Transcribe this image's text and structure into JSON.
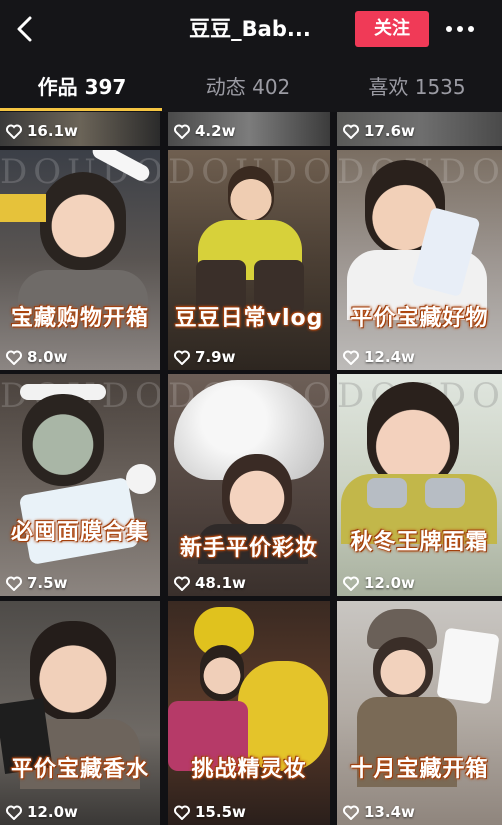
{
  "header": {
    "title": "豆豆_Bab...",
    "follow_label": "关注"
  },
  "tabs": [
    {
      "label": "作品 397"
    },
    {
      "label": "动态 402"
    },
    {
      "label": "喜欢 1535"
    }
  ],
  "grid": {
    "top_row": [
      {
        "likes": "16.1w"
      },
      {
        "likes": "4.2w"
      },
      {
        "likes": "17.6w"
      }
    ],
    "videos": [
      {
        "caption": "宝藏购物开箱",
        "likes": "8.0w",
        "watermark": "DOUDOU"
      },
      {
        "caption": "豆豆日常vlog",
        "likes": "7.9w",
        "watermark": "DOUDOU"
      },
      {
        "caption": "平价宝藏好物",
        "likes": "12.4w",
        "watermark": "DOUDOU"
      },
      {
        "caption": "必囤面膜合集",
        "likes": "7.5w",
        "watermark": "DOUDOU"
      },
      {
        "caption": "新手平价彩妆",
        "likes": "48.1w",
        "watermark": "DOUDOU"
      },
      {
        "caption": "秋冬王牌面霜",
        "likes": "12.0w",
        "watermark": "DOUDOU"
      },
      {
        "caption": "平价宝藏香水",
        "likes": "12.0w",
        "watermark": ""
      },
      {
        "caption": "挑战精灵妆",
        "likes": "15.5w",
        "watermark": ""
      },
      {
        "caption": "十月宝藏开箱",
        "likes": "13.4w",
        "watermark": ""
      }
    ]
  },
  "colors": {
    "accent_follow": "#f03a57",
    "tab_indicator": "#f5c542",
    "caption_outline": "#b44a10"
  },
  "icons": {
    "back": "chevron-left-icon",
    "more": "more-dots-icon",
    "like": "heart-icon"
  }
}
